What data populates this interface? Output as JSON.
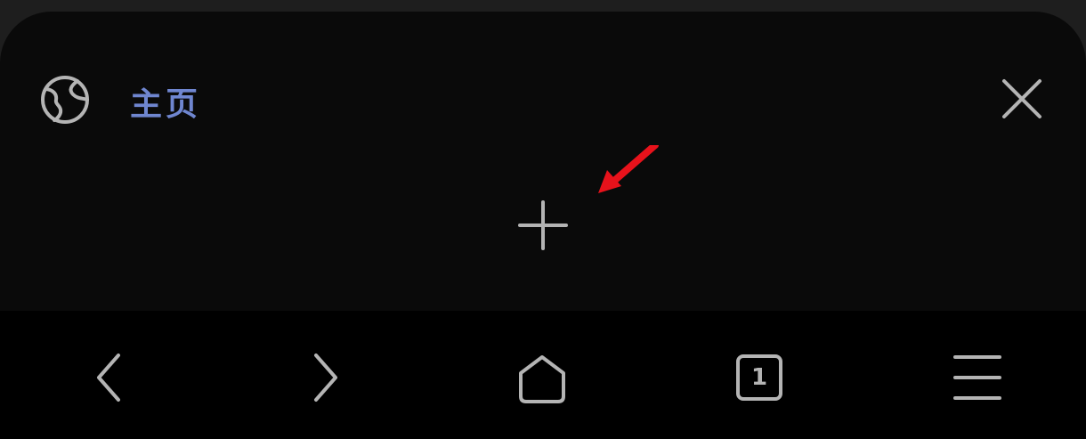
{
  "tab": {
    "title": "主页",
    "title_color": "#6f86d0",
    "favicon_icon": "globe-icon",
    "close_icon": "close-icon"
  },
  "new_tab": {
    "icon": "plus-icon"
  },
  "annotation": {
    "icon": "arrow-icon",
    "color": "#e8121b"
  },
  "bottom_nav": {
    "back_icon": "chevron-left-icon",
    "forward_icon": "chevron-right-icon",
    "home_icon": "home-icon",
    "tab_count": "1",
    "menu_icon": "hamburger-menu-icon"
  },
  "colors": {
    "background": "#1e1e1e",
    "card": "#0a0a0a",
    "bar": "#000000",
    "icon": "#b4b4b4"
  }
}
